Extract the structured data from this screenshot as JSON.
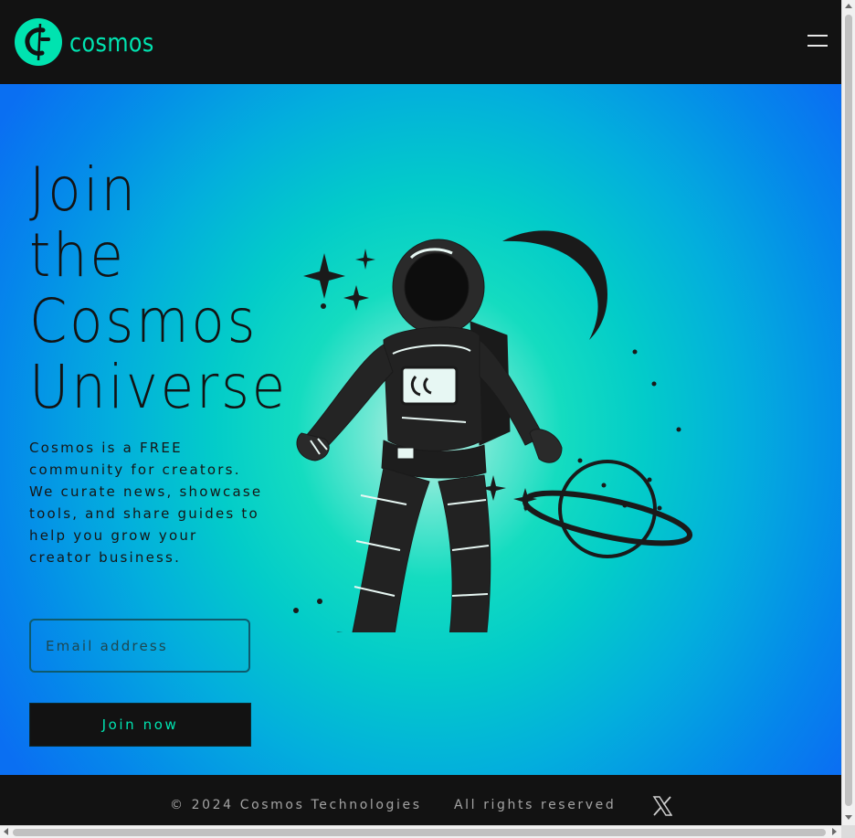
{
  "brand": {
    "name": "cosmos",
    "accent": "#00e3b0",
    "logo_icon": "cosmos-logo-icon"
  },
  "header": {
    "menu_icon": "hamburger-menu-icon"
  },
  "hero": {
    "headline_lines": [
      "Join",
      "the",
      "Cosmos",
      "Universe"
    ],
    "description": "Cosmos is a FREE community for creators. We curate news, showcase tools, and share guides to help you grow your creator business.",
    "email_placeholder": "Email address",
    "join_button_label": "Join now",
    "illustration": "astronaut-illustration"
  },
  "footer": {
    "copyright": "© 2024 Cosmos Technologies",
    "rights": "All rights reserved",
    "social_icon": "x-twitter-icon"
  },
  "colors": {
    "background_dark": "#121212",
    "accent": "#00e3b0",
    "gradient_center": "#c8eee6",
    "gradient_edge": "#0a6ff2"
  }
}
